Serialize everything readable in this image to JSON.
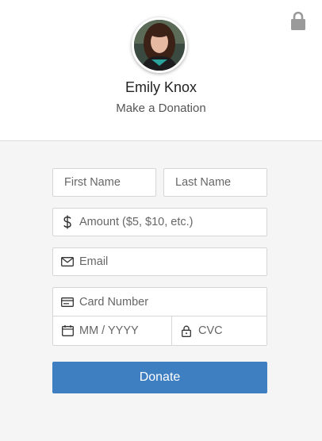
{
  "profile": {
    "name": "Emily Knox",
    "subtitle": "Make a Donation"
  },
  "form": {
    "first_name": {
      "placeholder": "First Name",
      "value": ""
    },
    "last_name": {
      "placeholder": "Last Name",
      "value": ""
    },
    "amount": {
      "placeholder": "Amount ($5, $10, etc.)",
      "value": "",
      "icon": "dollar-icon"
    },
    "email": {
      "placeholder": "Email",
      "value": "",
      "icon": "envelope-icon"
    },
    "card_number": {
      "placeholder": "Card Number",
      "value": "",
      "icon": "credit-card-icon"
    },
    "expiry": {
      "placeholder": "MM / YYYY",
      "value": "",
      "icon": "calendar-icon"
    },
    "cvc": {
      "placeholder": "CVC",
      "value": "",
      "icon": "lock-icon"
    }
  },
  "donate_button": {
    "label": "Donate",
    "color": "#3e7fc1"
  },
  "header_icon": "padlock-icon",
  "colors": {
    "header_bg": "#ffffff",
    "page_bg": "#f5f5f5",
    "lock_icon": "#9a9a9a"
  }
}
